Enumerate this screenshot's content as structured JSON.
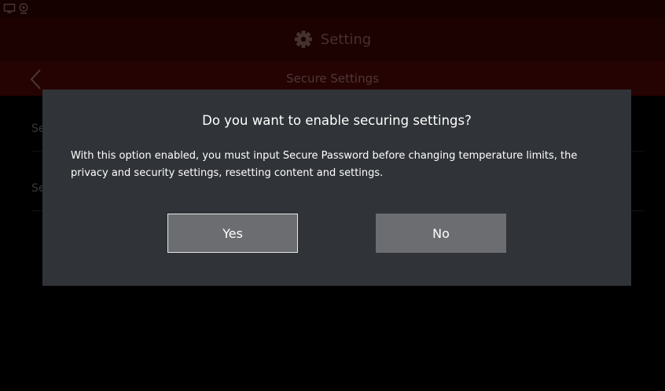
{
  "header": {
    "title": "Setting",
    "icon": "gear-icon"
  },
  "subheader": {
    "title": "Secure Settings",
    "back_icon": "chevron-left-icon"
  },
  "statusbar": {
    "icons": [
      "monitor-icon",
      "webcam-icon"
    ]
  },
  "list": {
    "items": [
      {
        "label": "Se"
      },
      {
        "label": "Se"
      }
    ]
  },
  "dialog": {
    "title": "Do you want to enable securing settings?",
    "message": "With this option enabled, you must input Secure Password before changing temperature limits, the privacy and security settings, resetting content and settings.",
    "yes_label": "Yes",
    "no_label": "No"
  },
  "colors": {
    "header_bg": "#2d0404",
    "subheader_bg": "#3a0505",
    "dialog_bg": "#303337",
    "button_bg": "#6b6d70"
  }
}
